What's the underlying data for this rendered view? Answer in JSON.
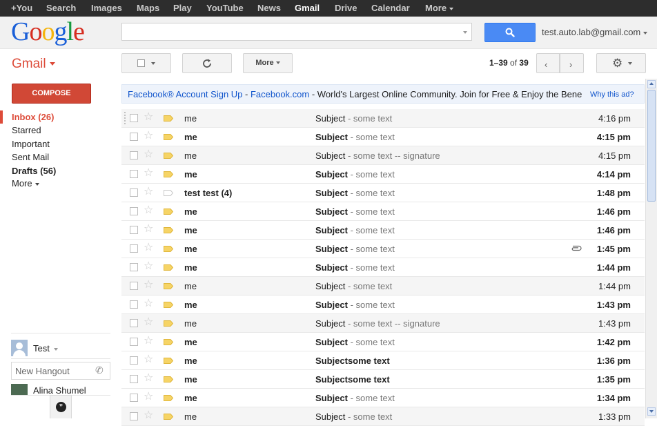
{
  "topbar": {
    "items": [
      "+You",
      "Search",
      "Images",
      "Maps",
      "Play",
      "YouTube",
      "News",
      "Gmail",
      "Drive",
      "Calendar",
      "More"
    ],
    "active": "Gmail"
  },
  "header": {
    "logo": [
      "G",
      "o",
      "o",
      "g",
      "l",
      "e"
    ],
    "search_value": "",
    "user_email": "test.auto.lab@gmail.com"
  },
  "app_label": "Gmail",
  "toolbar": {
    "more_label": "More",
    "pager_range": "1–39",
    "pager_of": "of",
    "pager_total": "39",
    "prev_icon": "‹",
    "next_icon": "›"
  },
  "nav": {
    "compose": "COMPOSE",
    "inbox": "Inbox (26)",
    "starred": "Starred",
    "important": "Important",
    "sent": "Sent Mail",
    "drafts": "Drafts (56)",
    "more": "More"
  },
  "hangouts": {
    "me": "Test",
    "input_placeholder": "New Hangout",
    "contact": "Alina Shumel"
  },
  "ad": {
    "title": "Facebook® Account Sign Up",
    "sep1": " - ",
    "domain": "Facebook.com",
    "sep2": " - ",
    "text": "World's Largest Online Community. Join for Free & Enjoy the Bene",
    "why": "Why this ad?"
  },
  "colors": {
    "accent_red": "#dd4b39",
    "compose_red": "#d14836",
    "search_blue": "#4a8af4",
    "link_blue": "#1155cc",
    "important_yellow": "#f6d466"
  },
  "messages": [
    {
      "sender": "me",
      "subject": "Subject",
      "snippet": " - some text",
      "time": "4:16 pm",
      "unread": false,
      "important": true,
      "attachment": false
    },
    {
      "sender": "me",
      "subject": "Subject",
      "snippet": " - some text",
      "time": "4:15 pm",
      "unread": true,
      "important": true,
      "attachment": false
    },
    {
      "sender": "me",
      "subject": "Subject",
      "snippet": " - some text -- signature",
      "time": "4:15 pm",
      "unread": false,
      "important": true,
      "attachment": false
    },
    {
      "sender": "me",
      "subject": "Subject",
      "snippet": " - some text",
      "time": "4:14 pm",
      "unread": true,
      "important": true,
      "attachment": false
    },
    {
      "sender": "test test (4)",
      "subject": "Subject",
      "snippet": " - some text",
      "time": "1:48 pm",
      "unread": true,
      "important": false,
      "attachment": false
    },
    {
      "sender": "me",
      "subject": "Subject",
      "snippet": " - some text",
      "time": "1:46 pm",
      "unread": true,
      "important": true,
      "attachment": false
    },
    {
      "sender": "me",
      "subject": "Subject",
      "snippet": " - some text",
      "time": "1:46 pm",
      "unread": true,
      "important": true,
      "attachment": false
    },
    {
      "sender": "me",
      "subject": "Subject",
      "snippet": " - some text",
      "time": "1:45 pm",
      "unread": true,
      "important": true,
      "attachment": true
    },
    {
      "sender": "me",
      "subject": "Subject",
      "snippet": " - some text",
      "time": "1:44 pm",
      "unread": true,
      "important": true,
      "attachment": false
    },
    {
      "sender": "me",
      "subject": "Subject",
      "snippet": " - some text",
      "time": "1:44 pm",
      "unread": false,
      "important": true,
      "attachment": false
    },
    {
      "sender": "me",
      "subject": "Subject",
      "snippet": " - some text",
      "time": "1:43 pm",
      "unread": true,
      "important": true,
      "attachment": false
    },
    {
      "sender": "me",
      "subject": "Subject",
      "snippet": " - some text -- signature",
      "time": "1:43 pm",
      "unread": false,
      "important": true,
      "attachment": false
    },
    {
      "sender": "me",
      "subject": "Subject",
      "snippet": " - some text",
      "time": "1:42 pm",
      "unread": true,
      "important": true,
      "attachment": false
    },
    {
      "sender": "me",
      "subject": "Subjectsome text",
      "snippet": "",
      "time": "1:36 pm",
      "unread": true,
      "important": true,
      "attachment": false
    },
    {
      "sender": "me",
      "subject": "Subjectsome text",
      "snippet": "",
      "time": "1:35 pm",
      "unread": true,
      "important": true,
      "attachment": false
    },
    {
      "sender": "me",
      "subject": "Subject",
      "snippet": " - some text",
      "time": "1:34 pm",
      "unread": true,
      "important": true,
      "attachment": false
    },
    {
      "sender": "me",
      "subject": "Subject",
      "snippet": " - some text",
      "time": "1:33 pm",
      "unread": false,
      "important": true,
      "attachment": false
    }
  ]
}
